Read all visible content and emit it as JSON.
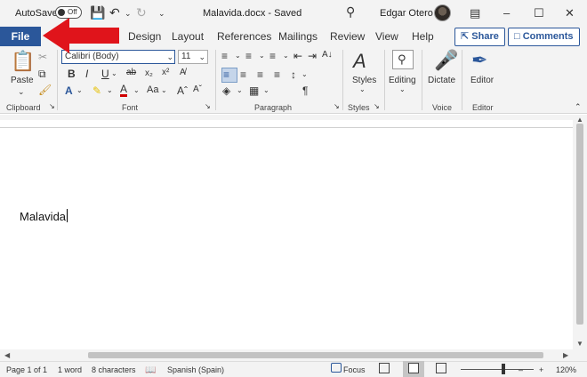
{
  "titlebar": {
    "autosave_label": "AutoSave",
    "autosave_state": "Off",
    "document_title": "Malavida.docx  -  Saved",
    "user_name": "Edgar Otero",
    "minimize": "–",
    "restore": "☐",
    "close": "✕"
  },
  "tabs": {
    "file": "File",
    "items": [
      "Design",
      "Layout",
      "References",
      "Mailings",
      "Review",
      "View",
      "Help"
    ],
    "share": "Share",
    "comments": "Comments"
  },
  "ribbon": {
    "clipboard": {
      "paste_label": "Paste",
      "group_label": "Clipboard"
    },
    "font": {
      "font_name": "Calibri (Body)",
      "font_size": "11",
      "group_label": "Font"
    },
    "paragraph": {
      "group_label": "Paragraph"
    },
    "styles": {
      "button_label": "Styles",
      "group_label": "Styles"
    },
    "editing": {
      "button_label": "Editing"
    },
    "voice": {
      "button_label": "Dictate",
      "group_label": "Voice"
    },
    "editor": {
      "button_label": "Editor",
      "group_label": "Editor"
    }
  },
  "document": {
    "body_text": "Malavida"
  },
  "statusbar": {
    "page": "Page 1 of 1",
    "words": "1 word",
    "characters": "8 characters",
    "language": "Spanish (Spain)",
    "focus": "Focus",
    "zoom_minus": "–",
    "zoom_plus": "+",
    "zoom": "120%"
  },
  "colors": {
    "accent": "#2b579a",
    "arrow": "#e0141b"
  }
}
